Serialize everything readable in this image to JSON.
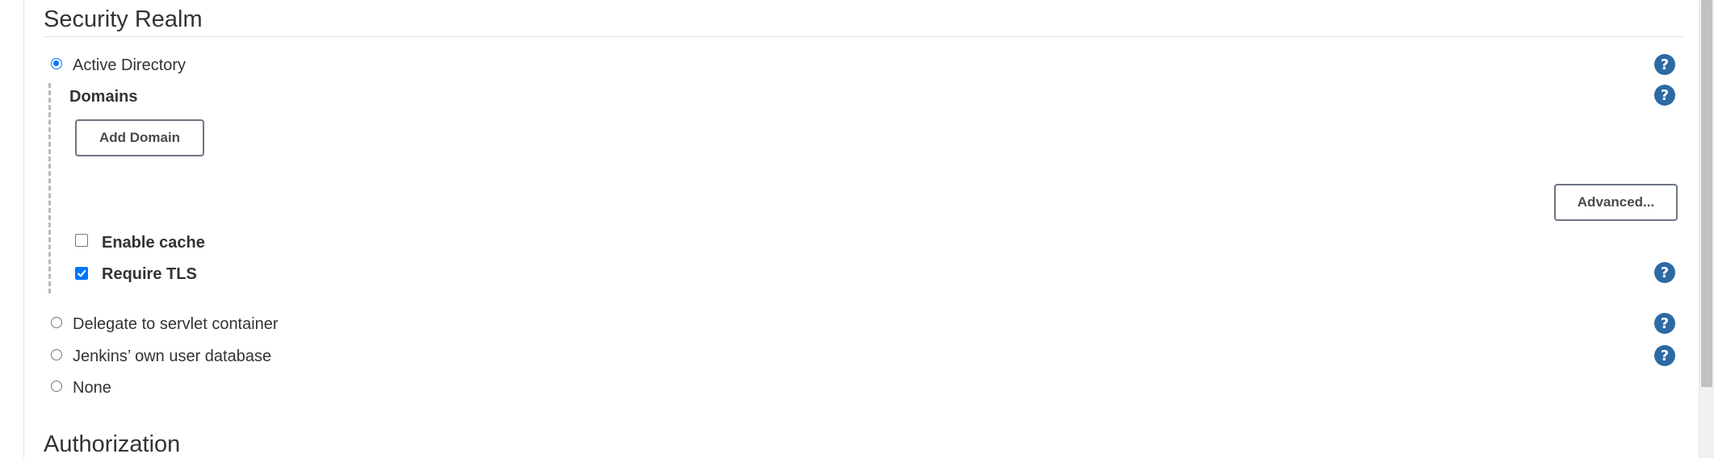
{
  "security_realm": {
    "title": "Security Realm",
    "options": [
      {
        "label": "Active Directory",
        "selected": true
      },
      {
        "label": "Delegate to servlet container",
        "selected": false
      },
      {
        "label": "Jenkins’ own user database",
        "selected": false
      },
      {
        "label": "None",
        "selected": false
      }
    ],
    "active_directory": {
      "domains_label": "Domains",
      "add_domain_button": "Add Domain",
      "advanced_button": "Advanced...",
      "enable_cache": {
        "label": "Enable cache",
        "checked": false
      },
      "require_tls": {
        "label": "Require TLS",
        "checked": true
      }
    },
    "help_icon_glyph": "?"
  },
  "authorization": {
    "title": "Authorization"
  },
  "colors": {
    "accent": "#0075ff",
    "help_icon": "#2d6aa3",
    "text": "#333333"
  },
  "icons": {
    "help": "help-icon",
    "checkmark": "checkmark-icon"
  }
}
